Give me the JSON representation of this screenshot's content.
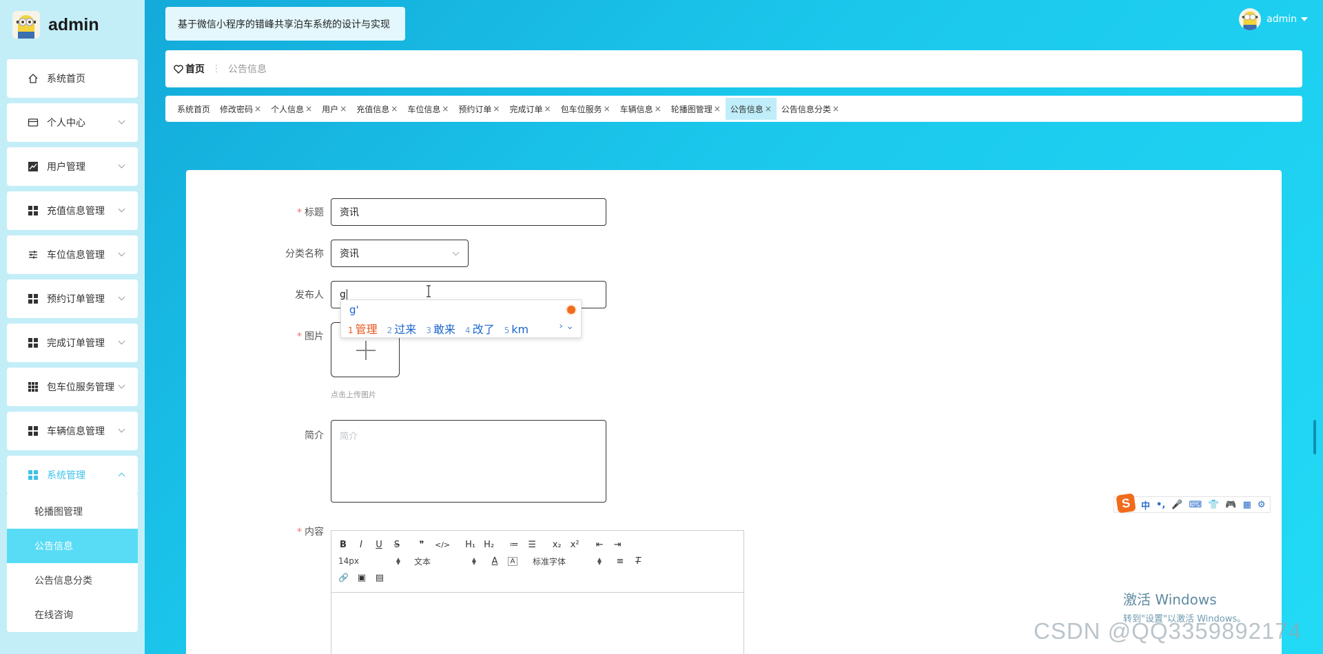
{
  "brand": {
    "title": "admin",
    "avatar_icon": "minion-avatar"
  },
  "header": {
    "system_title": "基于微信小程序的错峰共享泊车系统的设计与实现",
    "user_name": "admin"
  },
  "breadcrumb": {
    "home": "首页",
    "separator": "⋮",
    "current": "公告信息"
  },
  "sidebar": {
    "items": [
      {
        "label": "系统首页",
        "icon": "home-icon"
      },
      {
        "label": "个人中心",
        "icon": "card-icon"
      },
      {
        "label": "用户管理",
        "icon": "chart-icon"
      },
      {
        "label": "充值信息管理",
        "icon": "grid-icon"
      },
      {
        "label": "车位信息管理",
        "icon": "sliders-icon"
      },
      {
        "label": "预约订单管理",
        "icon": "grid-icon"
      },
      {
        "label": "完成订单管理",
        "icon": "grid-icon"
      },
      {
        "label": "包车位服务管理",
        "icon": "grid9-icon"
      },
      {
        "label": "车辆信息管理",
        "icon": "grid-icon"
      },
      {
        "label": "系统管理",
        "icon": "grid-icon"
      }
    ],
    "sub_items": [
      {
        "label": "轮播图管理"
      },
      {
        "label": "公告信息"
      },
      {
        "label": "公告信息分类"
      },
      {
        "label": "在线咨询"
      }
    ]
  },
  "tabs": [
    {
      "label": "系统首页",
      "close": ""
    },
    {
      "label": "修改密码",
      "close": "×"
    },
    {
      "label": "个人信息",
      "close": "×"
    },
    {
      "label": "用户",
      "close": "×"
    },
    {
      "label": "充值信息",
      "close": "×"
    },
    {
      "label": "车位信息",
      "close": "×"
    },
    {
      "label": "预约订单",
      "close": "×"
    },
    {
      "label": "完成订单",
      "close": "×"
    },
    {
      "label": "包车位服务",
      "close": "×"
    },
    {
      "label": "车辆信息",
      "close": "×"
    },
    {
      "label": "轮播图管理",
      "close": "×"
    },
    {
      "label": "公告信息",
      "close": "×"
    },
    {
      "label": "公告信息分类",
      "close": "×"
    }
  ],
  "form": {
    "title_label": "标题",
    "title_value": "资讯",
    "category_label": "分类名称",
    "category_value": "资讯",
    "publisher_label": "发布人",
    "publisher_value": "g",
    "image_label": "图片",
    "upload_hint": "点击上传图片",
    "intro_label": "简介",
    "intro_placeholder": "简介",
    "content_label": "内容",
    "required_mark": "*"
  },
  "editor": {
    "row1": [
      "B",
      "I",
      "U",
      "S",
      "❞",
      "</>",
      "H₁",
      "H₂",
      "≔",
      "☰",
      "x₂",
      "x²",
      "⇤",
      "⇥"
    ],
    "font_size": "14px",
    "text_style": "文本",
    "font_family": "标准字体",
    "row3": [
      "🔗",
      "▣",
      "▤"
    ]
  },
  "ime": {
    "composition": "g'",
    "candidates": [
      {
        "num": "1",
        "text": "管理"
      },
      {
        "num": "2",
        "text": "过来"
      },
      {
        "num": "3",
        "text": "敢来"
      },
      {
        "num": "4",
        "text": "改了"
      },
      {
        "num": "5",
        "text": "km"
      }
    ],
    "nav": "› ⌄",
    "status_bar": [
      "中",
      "•,",
      "🎤",
      "⌨",
      "👕",
      "🎮",
      "▦",
      "⚙"
    ],
    "status_logo": "S"
  },
  "watermark": {
    "activate_title": "激活 Windows",
    "activate_sub": "转到\"设置\"以激活 Windows。",
    "csdn": "CSDN @QQ3359892174"
  },
  "colors": {
    "accent": "#3ec2e8",
    "active_sub": "#58dcf6",
    "required": "#f56c6c"
  }
}
